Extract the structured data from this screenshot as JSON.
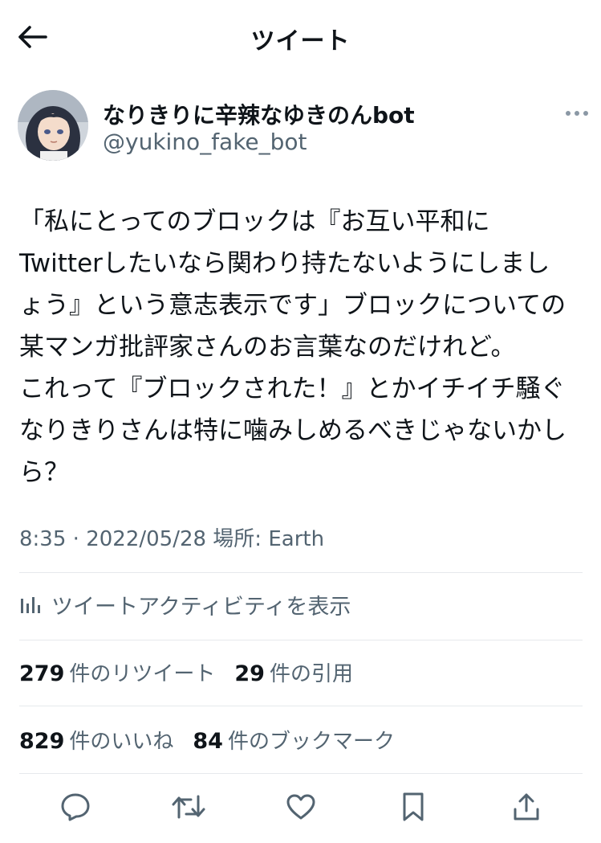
{
  "header": {
    "title": "ツイート",
    "back_icon": "arrow-left-icon"
  },
  "author": {
    "name": "なりきりに辛辣なゆきのんbot",
    "handle": "@yukino_fake_bot",
    "more_icon": "more-horizontal-icon"
  },
  "tweet": {
    "lines": [
      "「私にとってのブロックは『お互い平和に",
      "Twitterしたいなら関わり持たないようにしまし",
      "ょう』という意志表示です」ブロックについての",
      "某マンガ批評家さんのお言葉なのだけれど。",
      "これって『ブロックされた！』とかイチイチ騒ぐ",
      "なりきりさんは特に噛みしめるべきじゃないかし",
      "ら？"
    ]
  },
  "meta": {
    "time": "8:35",
    "separator": " · ",
    "date": "2022/05/28",
    "location": " 場所: Earth"
  },
  "activity": {
    "label": "ツイートアクティビティを表示",
    "icon": "analytics-icon"
  },
  "stats": {
    "retweets_count": "279",
    "retweets_label": "件のリツイート",
    "quotes_count": "29",
    "quotes_label": "件の引用",
    "likes_count": "829",
    "likes_label": "件のいいね",
    "bookmarks_count": "84",
    "bookmarks_label": "件のブックマーク"
  },
  "actions": [
    {
      "icon": "reply-icon"
    },
    {
      "icon": "retweet-icon"
    },
    {
      "icon": "like-icon"
    },
    {
      "icon": "bookmark-icon"
    },
    {
      "icon": "share-icon"
    }
  ],
  "colors": {
    "text": "#0f1419",
    "secondary": "#536471",
    "divider": "#e6e9ec"
  }
}
